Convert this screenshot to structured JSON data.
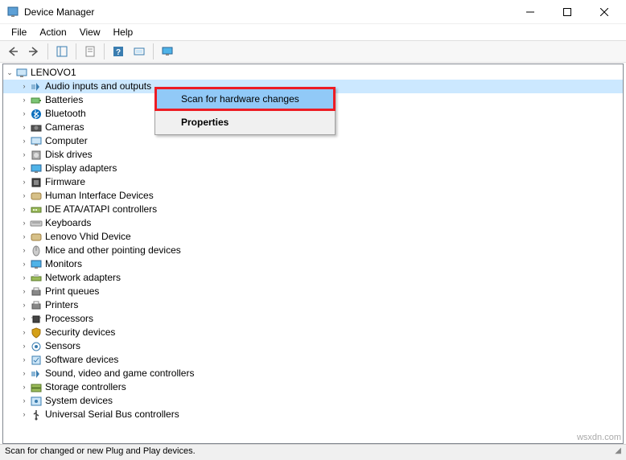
{
  "window": {
    "title": "Device Manager"
  },
  "menus": {
    "file": "File",
    "action": "Action",
    "view": "View",
    "help": "Help"
  },
  "tree": {
    "root": "LENOVO1",
    "items": [
      {
        "label": "Audio inputs and outputs",
        "icon": "audio",
        "selected": true
      },
      {
        "label": "Batteries",
        "icon": "battery"
      },
      {
        "label": "Bluetooth",
        "icon": "bluetooth"
      },
      {
        "label": "Cameras",
        "icon": "camera"
      },
      {
        "label": "Computer",
        "icon": "computer"
      },
      {
        "label": "Disk drives",
        "icon": "disk"
      },
      {
        "label": "Display adapters",
        "icon": "display"
      },
      {
        "label": "Firmware",
        "icon": "firmware"
      },
      {
        "label": "Human Interface Devices",
        "icon": "hid"
      },
      {
        "label": "IDE ATA/ATAPI controllers",
        "icon": "ide"
      },
      {
        "label": "Keyboards",
        "icon": "keyboard"
      },
      {
        "label": "Lenovo Vhid Device",
        "icon": "hid"
      },
      {
        "label": "Mice and other pointing devices",
        "icon": "mouse"
      },
      {
        "label": "Monitors",
        "icon": "monitor"
      },
      {
        "label": "Network adapters",
        "icon": "network"
      },
      {
        "label": "Print queues",
        "icon": "printer"
      },
      {
        "label": "Printers",
        "icon": "printer"
      },
      {
        "label": "Processors",
        "icon": "cpu"
      },
      {
        "label": "Security devices",
        "icon": "security"
      },
      {
        "label": "Sensors",
        "icon": "sensor"
      },
      {
        "label": "Software devices",
        "icon": "software"
      },
      {
        "label": "Sound, video and game controllers",
        "icon": "sound"
      },
      {
        "label": "Storage controllers",
        "icon": "storage"
      },
      {
        "label": "System devices",
        "icon": "system"
      },
      {
        "label": "Universal Serial Bus controllers",
        "icon": "usb"
      }
    ]
  },
  "context_menu": {
    "scan": "Scan for hardware changes",
    "properties": "Properties"
  },
  "statusbar": {
    "text": "Scan for changed or new Plug and Play devices."
  },
  "watermark": "wsxdn.com"
}
